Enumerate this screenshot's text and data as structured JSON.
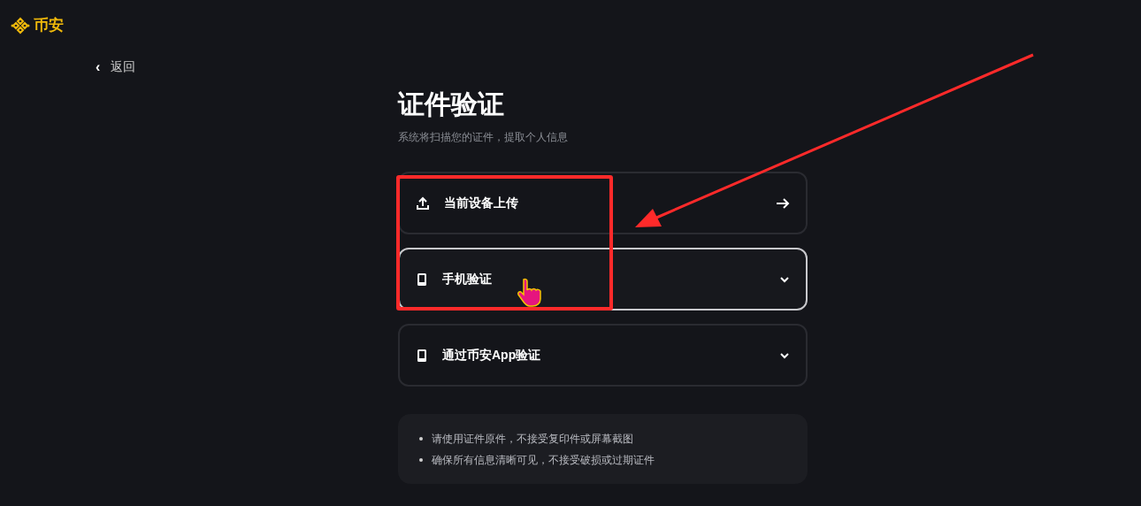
{
  "logo": {
    "text": "币安"
  },
  "back": {
    "icon": "‹",
    "label": "返回"
  },
  "title": "证件验证",
  "subtitle": "系统将扫描您的证件，提取个人信息",
  "options": [
    {
      "label": "当前设备上传",
      "kind": "link",
      "selected": false
    },
    {
      "label": "手机验证",
      "kind": "expand",
      "selected": true
    },
    {
      "label": "通过币安App验证",
      "kind": "expand",
      "selected": false
    }
  ],
  "tips": [
    "请使用证件原件，不接受复印件或屏幕截图",
    "确保所有信息清晰可见，不接受破损或过期证件"
  ]
}
